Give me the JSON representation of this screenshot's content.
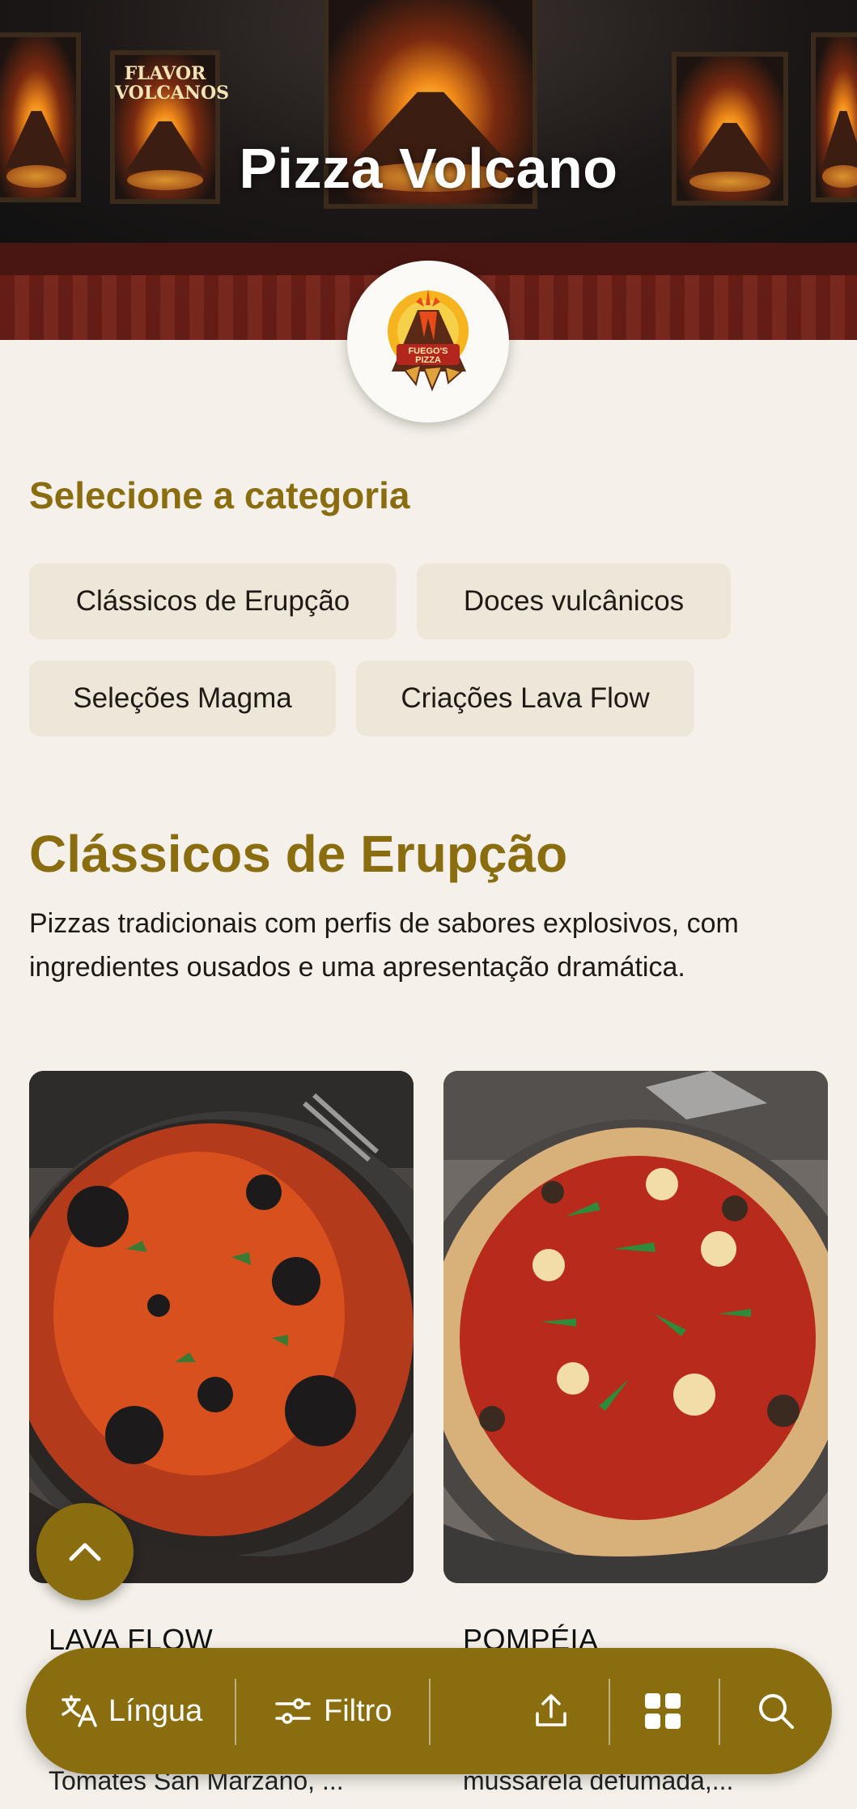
{
  "hero": {
    "title": "Pizza Volcano",
    "poster_text": "FLAVOR VOLCANOS",
    "logo_text": "FUEGO'S PIZZA"
  },
  "categories": {
    "heading": "Selecione a categoria",
    "chips": [
      {
        "label": "Clássicos de Erupção"
      },
      {
        "label": "Doces vulcânicos"
      },
      {
        "label": "Seleções Magma"
      },
      {
        "label": "Criações Lava Flow"
      }
    ]
  },
  "section": {
    "title": "Clássicos de Erupção",
    "description": "Pizzas tradicionais com perfis de sabores explosivos, com ingredientes ousados e uma apresentação dramática."
  },
  "items": [
    {
      "name": "LAVA FLOW",
      "description": "Tomates San Marzano, ..."
    },
    {
      "name": "POMPÉIA",
      "description": "mussarela defumada,..."
    }
  ],
  "toolbar": {
    "language_label": "Língua",
    "filter_label": "Filtro"
  },
  "colors": {
    "accent": "#8a6d0e",
    "background": "#f5f1ea",
    "chip": "#ece7d8"
  }
}
